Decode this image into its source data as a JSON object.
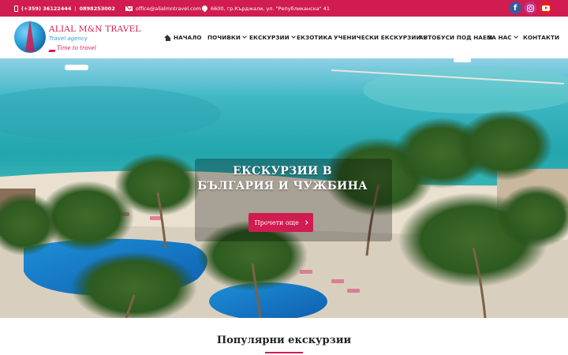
{
  "topbar": {
    "phone1": "(+359) 36122444",
    "separator": "|",
    "phone2": "0898253002",
    "email": "office@alialmntravel.com",
    "address": "6600, гр.Кърджали, ул. \"Републиканска\" 41",
    "social": [
      {
        "name": "facebook",
        "glyph": "f"
      },
      {
        "name": "instagram",
        "glyph": ""
      },
      {
        "name": "youtube",
        "glyph": ""
      }
    ],
    "colors": {
      "background": "#d01c50",
      "facebook": "#3b5998",
      "instagram": "#c13584",
      "youtube": "#e62117"
    }
  },
  "logo": {
    "title": "ALIAL M&N TRAVEL",
    "subtitle": "Travel agency",
    "slogan": "Time to travel"
  },
  "nav": {
    "items": [
      {
        "label": "НАЧАЛО",
        "icon": "home-icon",
        "dropdown": false
      },
      {
        "label": "ПОЧИВКИ",
        "dropdown": true
      },
      {
        "label": "ЕКСКУРЗИИ",
        "dropdown": true
      },
      {
        "label": "ЕКЗОТИКА",
        "dropdown": false
      },
      {
        "label": "УЧЕНИЧЕСКИ ЕКСКУРЗИИ",
        "dropdown": true
      },
      {
        "label": "АВТОБУСИ ПОД НАЕМ",
        "dropdown": false
      },
      {
        "label": "ЗА НАС",
        "dropdown": true
      },
      {
        "label": "КОНТАКТИ",
        "dropdown": false
      }
    ]
  },
  "hero": {
    "title": "ЕКСКУРЗИИ В БЪЛГАРИЯ И ЧУЖБИНА",
    "button_label": "Прочети още"
  },
  "popular": {
    "title": "Популярни екскурзии"
  },
  "colors": {
    "accent": "#d01c50",
    "sea": "#2bb3b8",
    "sky": "#bfe3f3"
  }
}
